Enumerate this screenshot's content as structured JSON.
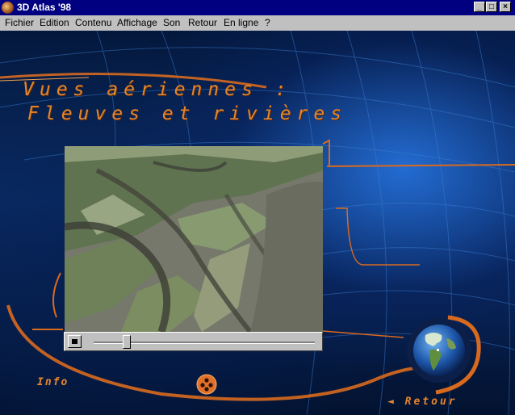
{
  "window": {
    "title": "3D Atlas '98",
    "controls": {
      "minimize": "_",
      "maximize": "□",
      "close": "×"
    }
  },
  "menubar": {
    "items": [
      {
        "label": "Fichier"
      },
      {
        "label": "Edition"
      },
      {
        "label": "Contenu"
      },
      {
        "label": "Affichage"
      },
      {
        "label": "Son"
      },
      {
        "label": "Retour"
      },
      {
        "label": "En ligne"
      },
      {
        "label": "?"
      }
    ]
  },
  "page": {
    "heading_line1": "Vues aériennes :",
    "heading_line2": "Fleuves et rivières",
    "info_label": "Info",
    "retour_label": "◄ Retour"
  },
  "video": {
    "progress": 0.15
  },
  "icons": {
    "app": "globe-app-icon",
    "stop": "stop-icon",
    "menu_orb": "orb-menu-icon",
    "globe": "earth-globe-icon"
  },
  "colors": {
    "accent_orange": "#e4862e",
    "title_bar": "#000080",
    "background_blue": "#0a2c66"
  }
}
